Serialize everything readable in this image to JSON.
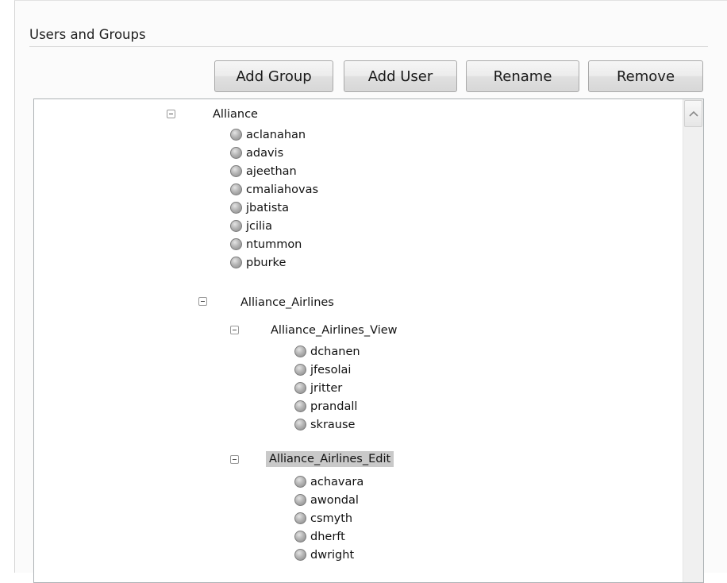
{
  "section": {
    "title": "Users and Groups"
  },
  "toolbar": {
    "add_group": "Add Group",
    "add_user": "Add User",
    "rename": "Rename",
    "remove": "Remove"
  },
  "tree": {
    "selected_group": "Alliance_Airlines_Edit",
    "groups": [
      {
        "name": "Alliance",
        "users": [
          "aclanahan",
          "adavis",
          "ajeethan",
          "cmaliahovas",
          "jbatista",
          "jcilia",
          "ntummon",
          "pburke"
        ]
      },
      {
        "name": "Alliance_Airlines",
        "users": []
      },
      {
        "name": "Alliance_Airlines_View",
        "users": [
          "dchanen",
          "jfesolai",
          "jritter",
          "prandall",
          "skrause"
        ]
      },
      {
        "name": "Alliance_Airlines_Edit",
        "users": [
          "achavara",
          "awondal",
          "csmyth",
          "dherft",
          "dwright"
        ]
      }
    ]
  },
  "icons": {
    "collapse": "collapse-minus-icon",
    "user": "user-icon",
    "scroll_up": "scroll-up-arrow-icon"
  },
  "colors": {
    "selection": "#c9c9c9",
    "panel_bg": "#fbfbfb"
  }
}
